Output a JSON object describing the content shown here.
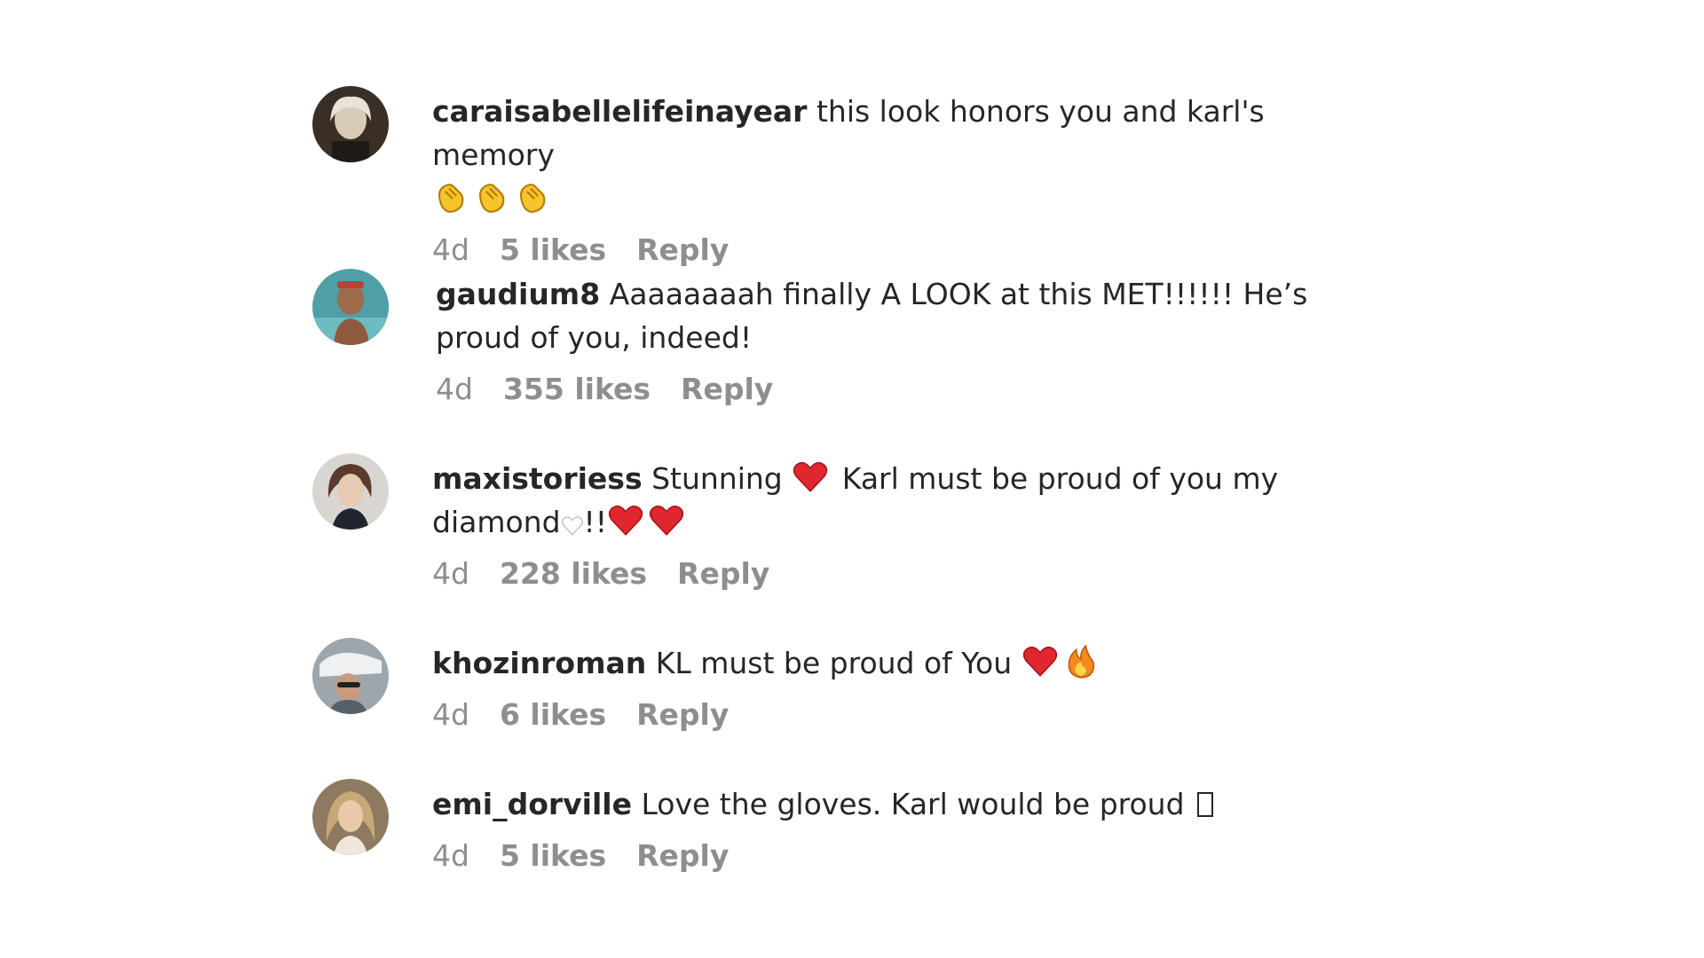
{
  "comments": [
    {
      "username": "caraisabellelifeinayear",
      "text": "this look honors you and karl's memory",
      "emojis_line2": [
        "clapping-hands",
        "clapping-hands",
        "clapping-hands"
      ],
      "time": "4d",
      "likes": "5 likes",
      "reply": "Reply",
      "avatar_colors": {
        "bg": "#3a2f26",
        "face": "#d8cbb8"
      }
    },
    {
      "username": "gaudium8",
      "text": "Aaaaaaaah finally A LOOK at this MET!!!!!! He’s proud of you, indeed!",
      "time": "4d",
      "likes": "355 likes",
      "reply": "Reply",
      "avatar_colors": {
        "bg": "#4f9fa6",
        "face": "#a06a4d"
      }
    },
    {
      "username": "maxistoriess",
      "text_part1": "Stunning",
      "text_part2": "Karl must be proud of you my diamond",
      "text_part3": "!!",
      "time": "4d",
      "likes": "228 likes",
      "reply": "Reply",
      "avatar_colors": {
        "bg": "#d9d6d1",
        "face": "#e7c9b4"
      }
    },
    {
      "username": "khozinroman",
      "text": "KL must be proud of You",
      "time": "4d",
      "likes": "6 likes",
      "reply": "Reply",
      "avatar_colors": {
        "bg": "#9da6ab",
        "face": "#c89a80"
      }
    },
    {
      "username": "emi_dorville",
      "text": "Love the gloves. Karl would be proud",
      "time": "4d",
      "likes": "5 likes",
      "reply": "Reply",
      "avatar_colors": {
        "bg": "#8d7a60",
        "face": "#e9c9a9"
      }
    }
  ],
  "colors": {
    "text": "#262626",
    "muted": "#8e8e8e",
    "heart": "#e0262f",
    "clap": "#f7c42b",
    "fire": "#f28a1f"
  }
}
